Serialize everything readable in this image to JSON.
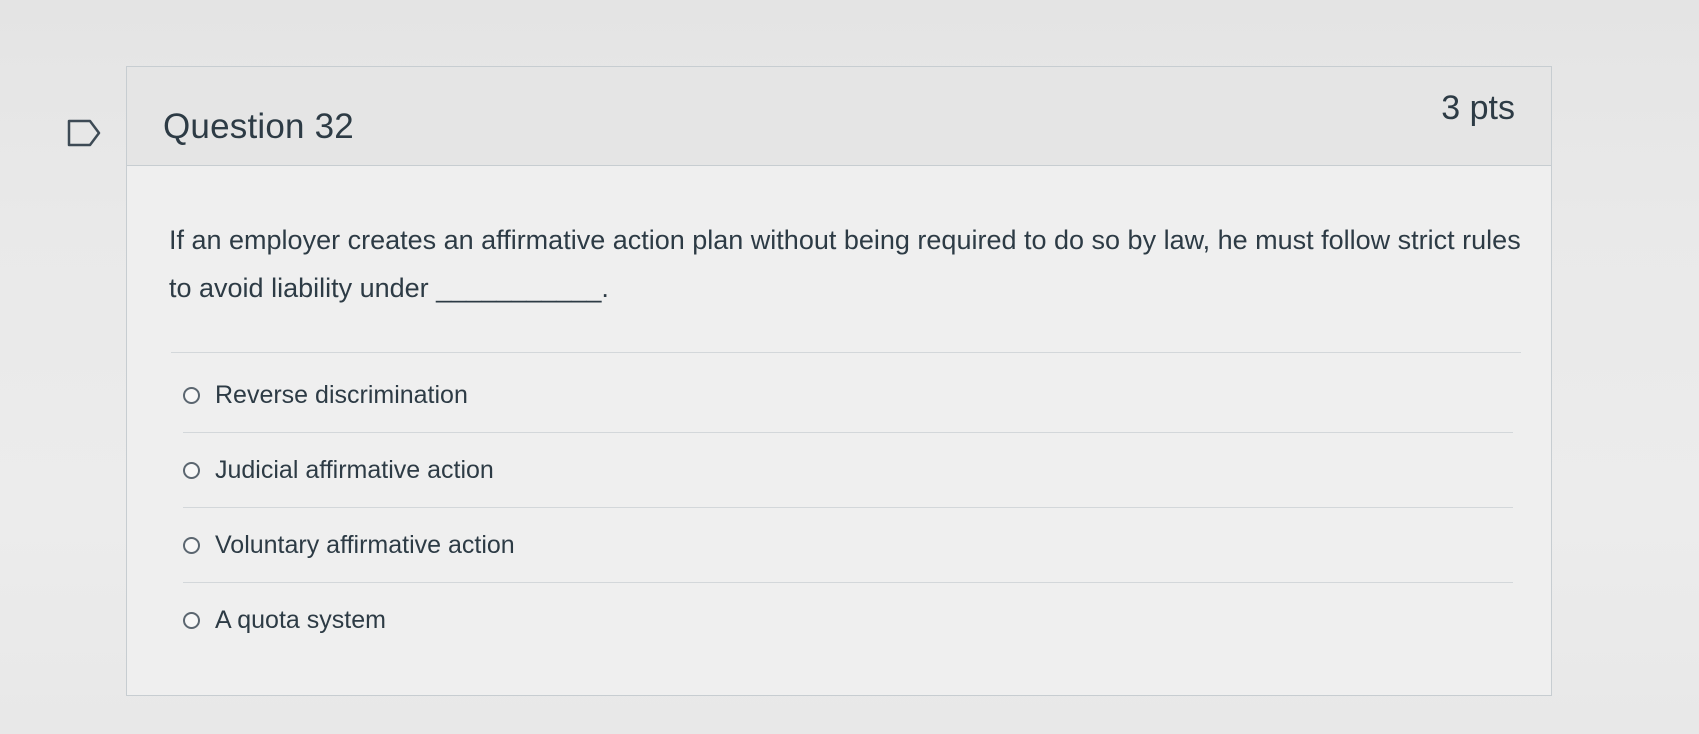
{
  "question": {
    "title": "Question 32",
    "points": "3 pts",
    "text": "If an employer creates an affirmative action plan without being required to do so by law, he must follow strict rules to avoid liability under ___________."
  },
  "answers": [
    {
      "label": "Reverse discrimination",
      "selected": false
    },
    {
      "label": "Judicial affirmative action",
      "selected": false
    },
    {
      "label": "Voluntary affirmative action",
      "selected": false
    },
    {
      "label": "A quota system",
      "selected": false
    }
  ],
  "icons": {
    "flag": "flag-question-icon",
    "radio": "radio-button-icon"
  },
  "colors": {
    "text": "#2d3b45",
    "border": "#c7cdd1",
    "header_background": "#e5e5e5"
  }
}
